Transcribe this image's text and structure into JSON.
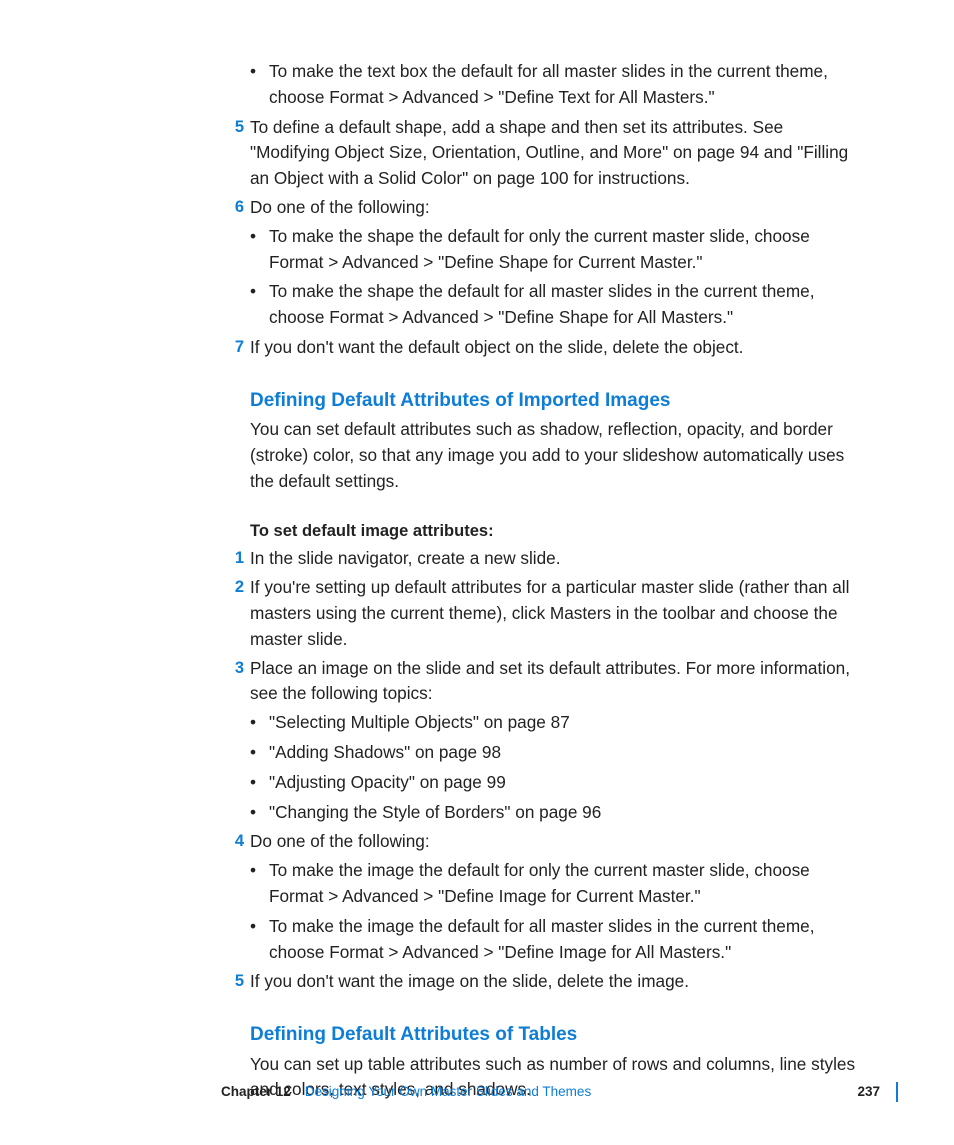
{
  "top": {
    "bullet1": "To make the text box the default for all master slides in the current theme, choose Format > Advanced > \"Define Text for All Masters.\""
  },
  "steps1": {
    "n5": "5",
    "t5": "To define a default shape, add a shape and then set its attributes. See \"Modifying Object Size, Orientation, Outline, and More\" on page 94 and \"Filling an Object with a Solid Color\" on page 100 for instructions.",
    "n6": "6",
    "t6": "Do one of the following:",
    "b6a": "To make the shape the default for only the current master slide, choose Format > Advanced > \"Define Shape for Current Master.\"",
    "b6b": "To make the shape the default for all master slides in the current theme, choose Format > Advanced > \"Define Shape for All Masters.\"",
    "n7": "7",
    "t7": "If you don't want the default object on the slide, delete the object."
  },
  "sec_images": {
    "heading": "Defining Default Attributes of Imported Images",
    "intro": "You can set default attributes such as shadow, reflection, opacity, and border (stroke) color, so that any image you add to your slideshow automatically uses the default settings.",
    "sub": "To set default image attributes:",
    "n1": "1",
    "t1": "In the slide navigator, create a new slide.",
    "n2": "2",
    "t2": "If you're setting up default attributes for a particular master slide (rather than all masters using the current theme), click Masters in the toolbar and choose the master slide.",
    "n3": "3",
    "t3": "Place an image on the slide and set its default attributes. For more information, see the following topics:",
    "b3a": "\"Selecting Multiple Objects\" on page 87",
    "b3b": "\"Adding Shadows\" on page 98",
    "b3c": "\"Adjusting Opacity\" on page 99",
    "b3d": "\"Changing the Style of Borders\" on page 96",
    "n4": "4",
    "t4": "Do one of the following:",
    "b4a": "To make the image the default for only the current master slide, choose Format > Advanced > \"Define Image for Current Master.\"",
    "b4b": "To make the image the default for all master slides in the current theme, choose Format > Advanced > \"Define Image for All Masters.\"",
    "n5": "5",
    "t5": "If you don't want the image on the slide, delete the image."
  },
  "sec_tables": {
    "heading": "Defining Default Attributes of Tables",
    "intro": "You can set up table attributes such as number of rows and columns, line styles and colors, text styles, and shadows."
  },
  "footer": {
    "chapter_label": "Chapter 12",
    "chapter_title": "Designing Your Own Master Slides and Themes",
    "page": "237"
  }
}
